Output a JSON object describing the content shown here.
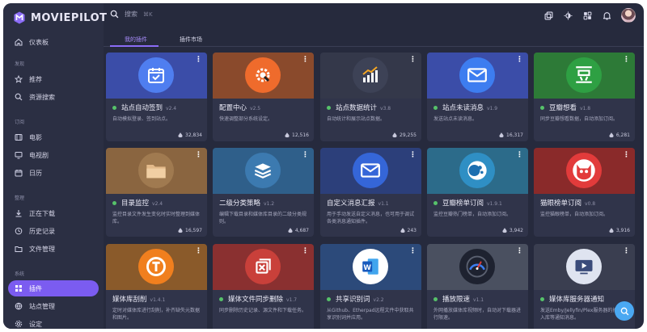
{
  "app": {
    "name": "MOVIEPILOT"
  },
  "sidebar": {
    "sections": [
      "发现",
      "订阅",
      "整理",
      "系统"
    ],
    "items": [
      {
        "label": "仪表板",
        "icon": "home-icon"
      },
      {
        "label": "推荐",
        "icon": "star-icon"
      },
      {
        "label": "资源搜索",
        "icon": "search-icon"
      },
      {
        "label": "电影",
        "icon": "film-icon"
      },
      {
        "label": "电视剧",
        "icon": "tv-icon"
      },
      {
        "label": "日历",
        "icon": "calendar-icon"
      },
      {
        "label": "正在下载",
        "icon": "download-icon"
      },
      {
        "label": "历史记录",
        "icon": "history-icon"
      },
      {
        "label": "文件管理",
        "icon": "folder-icon"
      },
      {
        "label": "插件",
        "icon": "apps-icon"
      },
      {
        "label": "站点管理",
        "icon": "globe-icon"
      },
      {
        "label": "设定",
        "icon": "settings-icon"
      }
    ]
  },
  "search": {
    "placeholder": "搜索",
    "shortcut": "⌘K"
  },
  "tabs": [
    "我的插件",
    "插件市场"
  ],
  "colors": {
    "accent": "#7b5cf0",
    "enabled_dot": "#56c26a",
    "fab": "#4aa8f2"
  },
  "plugins": [
    {
      "title": "站点自动签到",
      "version": "v2.4",
      "desc": "自动模拟登录、签到站点。",
      "count": "32,834",
      "enabled": true,
      "bg": "#3b4da8",
      "icon_bg": "#4f7ef0",
      "icon": "calendar-check-icon"
    },
    {
      "title": "配置中心",
      "version": "v2.5",
      "desc": "快速调整部分系统设定。",
      "count": "12,516",
      "enabled": false,
      "bg": "#8a4a2c",
      "icon_bg": "#ef6b2c",
      "icon": "gear-wrench-icon"
    },
    {
      "title": "站点数据统计",
      "version": "v3.8",
      "desc": "自动统计和展示站点数据。",
      "count": "29,255",
      "enabled": true,
      "bg": "#34384a",
      "icon_bg": "#3d4256",
      "icon": "bar-chart-icon"
    },
    {
      "title": "站点未读消息",
      "version": "v1.9",
      "desc": "发送站点未读消息。",
      "count": "16,317",
      "enabled": true,
      "bg": "#3b4da8",
      "icon_bg": "#3d7df0",
      "icon": "mail-icon"
    },
    {
      "title": "豆瓣想看",
      "version": "v1.8",
      "desc": "同步豆瓣想看数据，自动添加订阅。",
      "count": "6,281",
      "enabled": true,
      "bg": "#2d7a37",
      "icon_bg": "#2ea043",
      "icon": "douban-icon"
    },
    {
      "title": "目录监控",
      "version": "v2.4",
      "desc": "监控目录文件发生变化时实时整理到媒体库。",
      "count": "16,597",
      "enabled": true,
      "bg": "#8a6540",
      "icon_bg": "#a07a50",
      "icon": "folder-icon"
    },
    {
      "title": "二级分类策略",
      "version": "v1.2",
      "desc": "编辑下载目录和媒体库目录的二级分类规则。",
      "count": "4,687",
      "enabled": false,
      "bg": "#2f5f8a",
      "icon_bg": "#3c7ab0",
      "icon": "layers-icon"
    },
    {
      "title": "自定义消息汇报",
      "version": "v1.1",
      "desc": "用于手动发送自定义消息，也可用于调试各类消息通知插件。",
      "count": "243",
      "enabled": false,
      "bg": "#2c3f7a",
      "icon_bg": "#3566d8",
      "icon": "mail-icon"
    },
    {
      "title": "豆瓣榜单订阅",
      "version": "v1.9.1",
      "desc": "监控豆瓣热门榜单，自动添加订阅。",
      "count": "3,942",
      "enabled": true,
      "bg": "#2c6b8a",
      "icon_bg": "#2f8fc4",
      "icon": "douban-logo-icon"
    },
    {
      "title": "猫眼榜单订阅",
      "version": "v0.8",
      "desc": "监控猫眼榜单，自动添加订阅。",
      "count": "3,916",
      "enabled": false,
      "bg": "#8a2a2a",
      "icon_bg": "#e23b3b",
      "icon": "cat-icon"
    },
    {
      "title": "媒体库刮削",
      "version": "v1.4.1",
      "desc": "定时对媒体库进行刮削，补齐缺失元数据和图片。",
      "count": "",
      "enabled": false,
      "bg": "#8a5a2a",
      "icon_bg": "#f07f1e",
      "icon": "scrape-icon"
    },
    {
      "title": "媒体文件同步删除",
      "version": "v1.7",
      "desc": "同步删除历史记录、源文件和下载任务。",
      "count": "",
      "enabled": true,
      "bg": "#8a3030",
      "icon_bg": "#c9403a",
      "icon": "sync-delete-icon"
    },
    {
      "title": "共享识别词",
      "version": "v2.2",
      "desc": "从Github、Etherpad远程文件中获取共享识别词并应用。",
      "count": "",
      "enabled": true,
      "bg": "#2c4a7a",
      "icon_bg": "#ffffff",
      "icon": "word-icon"
    },
    {
      "title": "播放限速",
      "version": "v1.1",
      "desc": "外网播放媒体库视频时，自动对下载器进行限速。",
      "count": "",
      "enabled": true,
      "bg": "#4a5060",
      "icon_bg": "#1e2230",
      "icon": "speedometer-icon"
    },
    {
      "title": "媒体库服务器通知",
      "version": "",
      "desc": "发送Emby/Jellyfin/Plex服务器的播放、入库等通知消息。",
      "count": "",
      "enabled": true,
      "bg": "#3a3e50",
      "icon_bg": "#dfe4f0",
      "icon": "media-server-icon"
    }
  ]
}
